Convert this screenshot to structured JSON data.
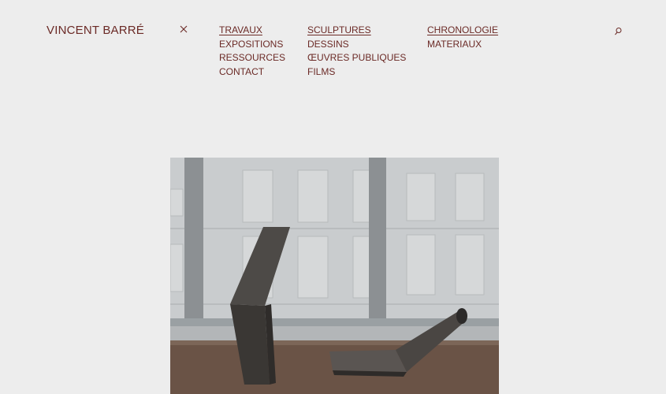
{
  "header": {
    "site_title": "VINCENT BARRÉ",
    "close_icon": "close-icon",
    "search_icon": "search-icon"
  },
  "nav": {
    "col1": [
      "TRAVAUX",
      "EXPOSITIONS",
      "RESSOURCES",
      "CONTACT"
    ],
    "col2": [
      "SCULPTURES",
      "DESSINS",
      "ŒUVRES PUBLIQUES",
      "FILMS"
    ],
    "col3": [
      "CHRONOLOGIE",
      "MATERIAUX"
    ]
  },
  "colors": {
    "background": "#ededed",
    "accent": "#6b2a26"
  }
}
